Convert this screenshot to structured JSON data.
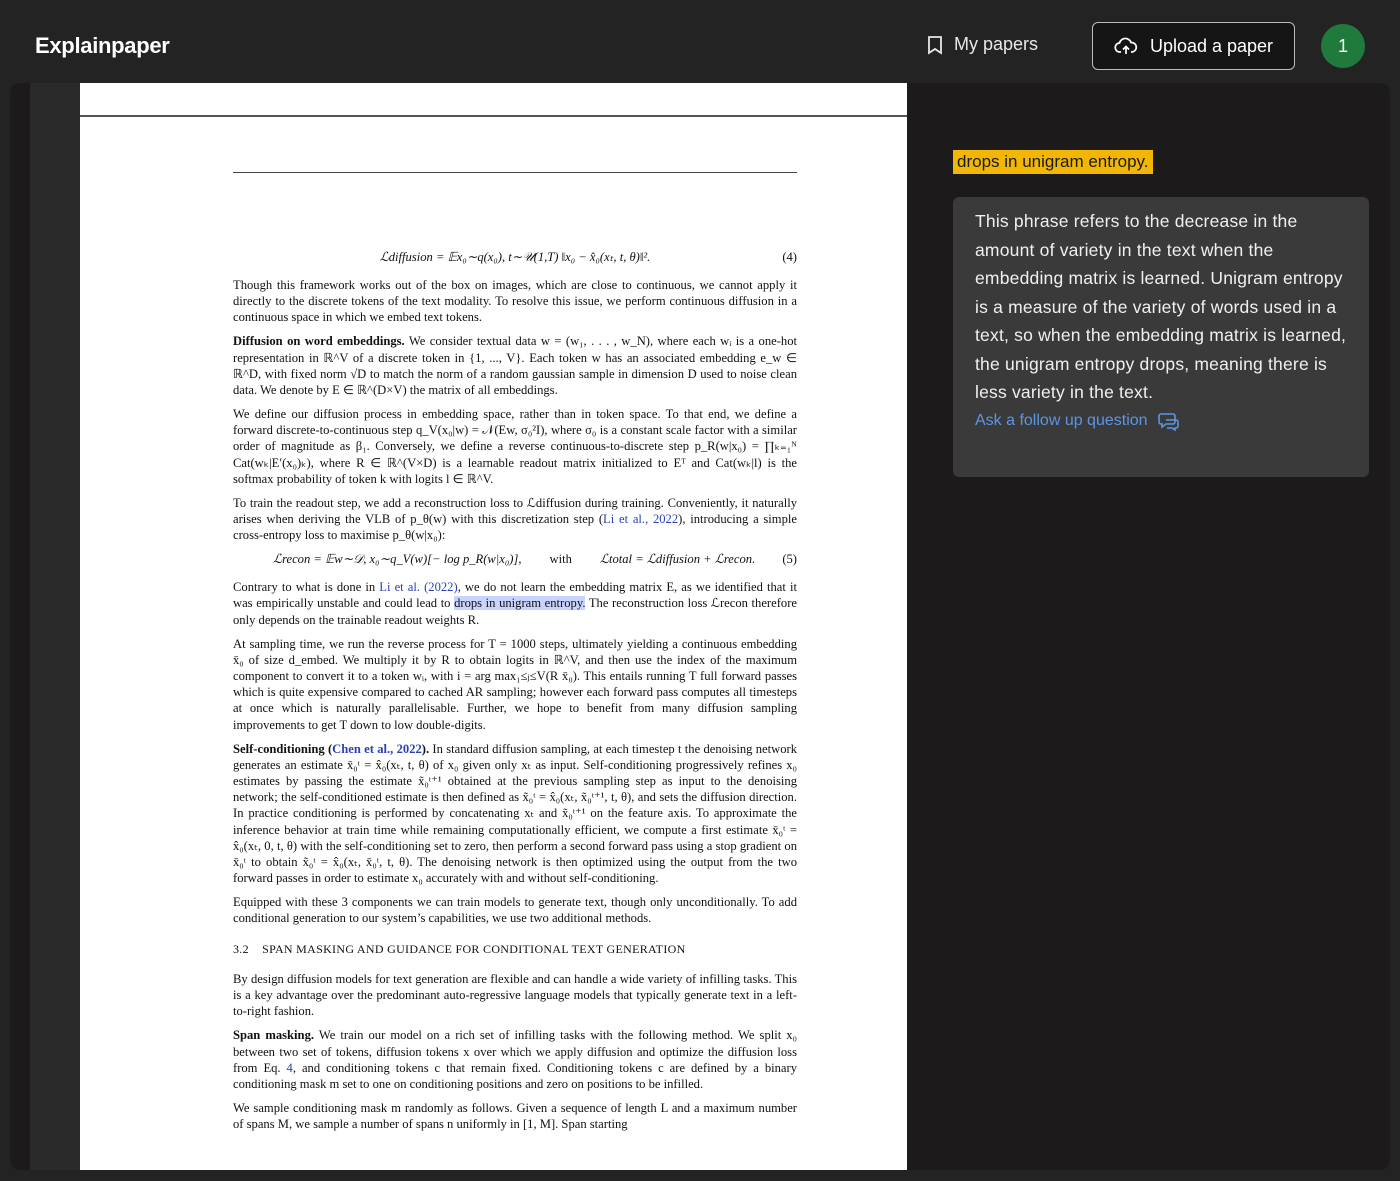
{
  "header": {
    "logo": "Explainpaper",
    "my_papers": "My papers",
    "upload": "Upload a paper",
    "avatar": "1"
  },
  "paper": {
    "eq4": {
      "text": "ℒdiffusion = 𝔼x₀∼q(x₀), t∼𝒰(1,T) ‖x₀ − x̂₀(xₜ, t, θ)‖².",
      "num": "(4)"
    },
    "p1": "Though this framework works out of the box on images, which are close to continuous, we cannot apply it directly to the discrete tokens of the text modality. To resolve this issue, we perform continuous diffusion in a continuous space in which we embed text tokens.",
    "p2_lead": "Diffusion on word embeddings.",
    "p2": " We consider textual data w = (w₁, . . . , w_N), where each wᵢ is a one-hot representation in ℝ^V of a discrete token in {1, ..., V}. Each token w has an associated embedding e_w ∈ ℝ^D, with fixed norm √D to match the norm of a random gaussian sample in dimension D used to noise clean data. We denote by E ∈ ℝ^(D×V) the matrix of all embeddings.",
    "p3": "We define our diffusion process in embedding space, rather than in token space. To that end, we define a forward discrete-to-continuous step q_V(x₀|w) = 𝒩(Ew, σ₀²I), where σ₀ is a constant scale factor with a similar order of magnitude as β₁. Conversely, we define a reverse continuous-to-discrete step p_R(w|x₀) = ∏ₖ₌₁ᴺ Cat(wₖ|E′(x₀)ₖ), where R ∈ ℝ^(V×D) is a learnable readout matrix initialized to Eᵀ and Cat(wₖ|l) is the softmax probability of token k with logits l ∈ ℝ^V.",
    "p4a": "To train the readout step, we add a reconstruction loss to ℒdiffusion during training. Conveniently, it naturally arises when deriving the VLB of p_θ(w) with this discretization step (",
    "p4_link": "Li et al., 2022",
    "p4b": "), introducing a simple cross-entropy loss to maximise p_θ(w|x₀):",
    "eq5": {
      "left": "ℒrecon = 𝔼w∼𝒟, x₀∼q_V(w)[− log p_R(w|x₀)],",
      "mid": "with",
      "right": "ℒtotal = ℒdiffusion + ℒrecon.",
      "num": "(5)"
    },
    "p5a": "Contrary to what is done in ",
    "p5_link": "Li et al. (2022)",
    "p5b": ", we do not learn the embedding matrix E, as we identified that it was empirically unstable and could lead to ",
    "p5_hl": "drops in unigram entropy.",
    "p5c": " The reconstruction loss ℒrecon therefore only depends on the trainable readout weights R.",
    "p6": "At sampling time, we run the reverse process for T = 1000 steps, ultimately yielding a continuous embedding x̄₀ of size d_embed. We multiply it by R to obtain logits in ℝ^V, and then use the index of the maximum component to convert it to a token wᵢ, with i = arg max₁≤ⱼ≤V(R x̄₀). This entails running T full forward passes which is quite expensive compared to cached AR sampling; however each forward pass computes all timesteps at once which is naturally parallelisable. Further, we hope to benefit from many diffusion sampling improvements to get T down to low double-digits.",
    "p7_lead": "Self-conditioning (",
    "p7_link": "Chen et al., 2022",
    "p7_lead2": ").",
    "p7": " In standard diffusion sampling, at each timestep t the denoising network generates an estimate x̄₀ᵗ = x̂₀(xₜ, t, θ) of x₀ given only xₜ as input. Self-conditioning progressively refines x₀ estimates by passing the estimate x̃₀ᵗ⁺¹ obtained at the previous sampling step as input to the denoising network; the self-conditioned estimate is then defined as x̃₀ᵗ = x̂₀(xₜ, x̃₀ᵗ⁺¹, t, θ), and sets the diffusion direction. In practice conditioning is performed by concatenating xₜ and x̃₀ᵗ⁺¹ on the feature axis. To approximate the inference behavior at train time while remaining computationally efficient, we compute a first estimate x̄₀ᵗ = x̂₀(xₜ, 0, t, θ) with the self-conditioning set to zero, then perform a second forward pass using a stop gradient on x̄₀ᵗ to obtain x̃₀ᵗ = x̂₀(xₜ, x̄₀ᵗ, t, θ). The denoising network is then optimized using the output from the two forward passes in order to estimate x₀ accurately with and without self-conditioning.",
    "p8": "Equipped with these 3 components we can train models to generate text, though only unconditionally. To add conditional generation to our system’s capabilities, we use two additional methods.",
    "h32": "3.2    SPAN MASKING AND GUIDANCE FOR CONDITIONAL TEXT GENERATION",
    "p9": "By design diffusion models for text generation are flexible and can handle a wide variety of infilling tasks. This is a key advantage over the predominant auto-regressive language models that typically generate text in a left-to-right fashion.",
    "p10_lead": "Span masking.",
    "p10a": " We train our model on a rich set of infilling tasks with the following method. We split x₀ between two set of tokens, diffusion tokens x over which we apply diffusion and optimize the diffusion loss from Eq. ",
    "p10_link": "4",
    "p10b": ", and conditioning tokens c that remain fixed. Conditioning tokens c are defined by a binary conditioning mask m set to one on conditioning positions and zero on positions to be infilled.",
    "p11": "We sample conditioning mask m randomly as follows. Given a sequence of length L and a maximum number of spans M, we sample a number of spans n uniformly in [1, M]. Span starting"
  },
  "explanation": {
    "selection": "drops in unigram entropy.",
    "text": "This phrase refers to the decrease in the amount of variety in the text when the embedding matrix is learned. Unigram entropy is a measure of the variety of words used in a text, so when the embedding matrix is learned, the unigram entropy drops, meaning there is less variety in the text.",
    "follow_up": "Ask a follow up question"
  },
  "colors": {
    "highlight": "#f2b705",
    "link": "#5b95e6",
    "avatar": "#1f7a3c"
  }
}
